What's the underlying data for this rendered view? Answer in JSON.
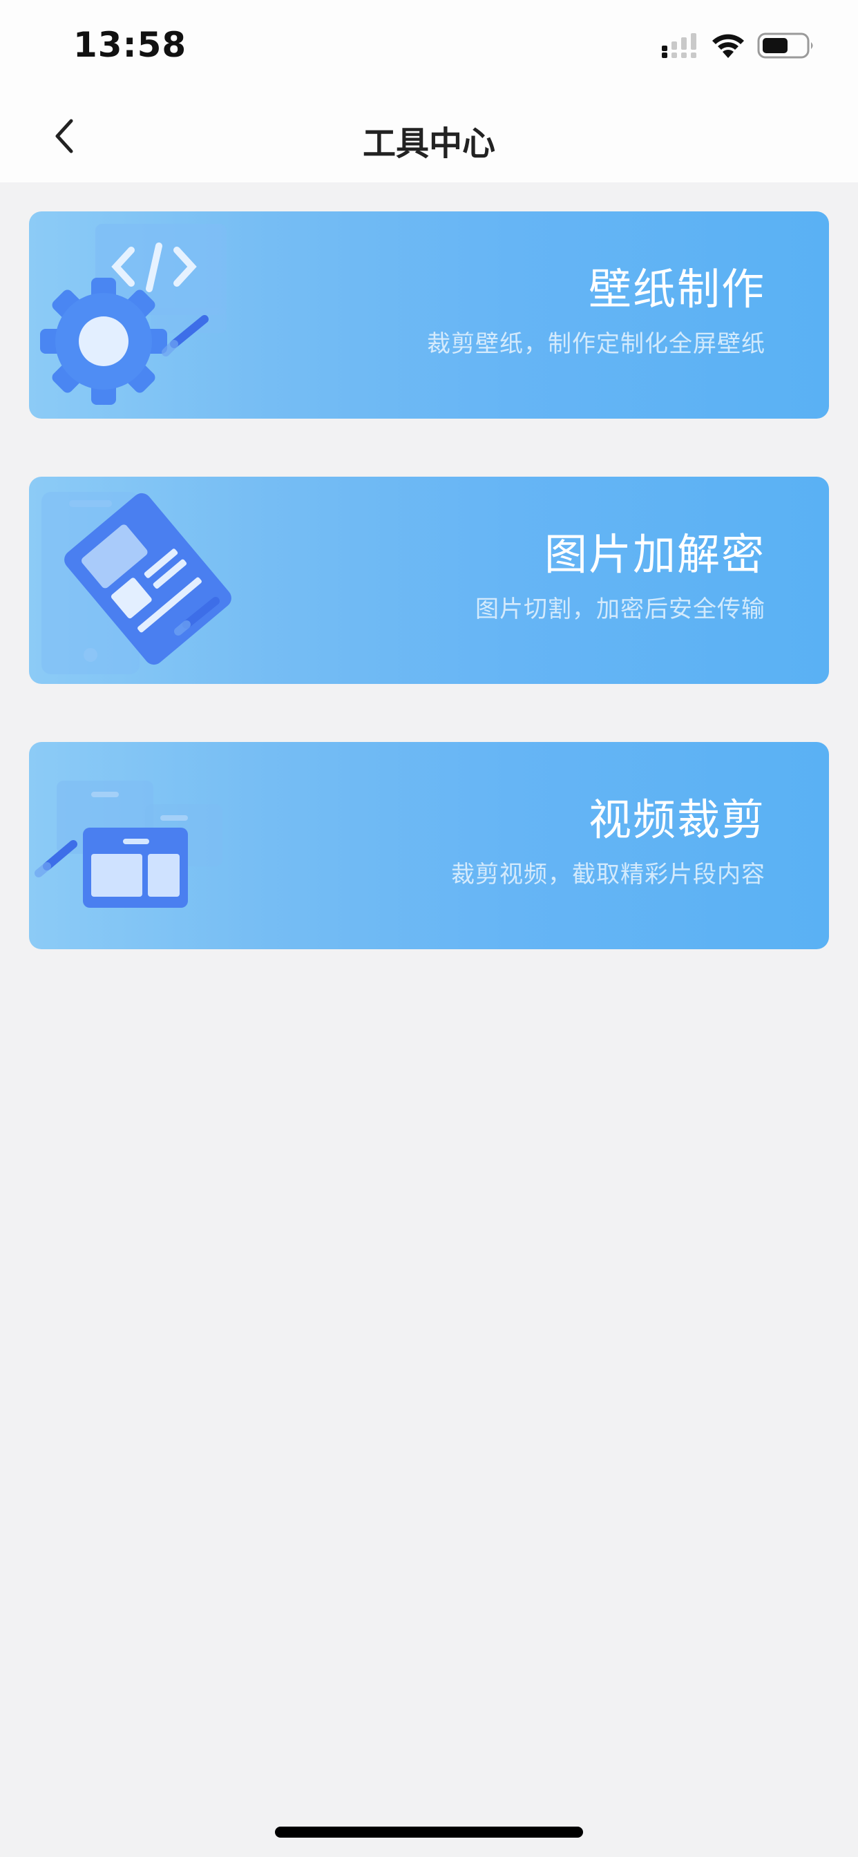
{
  "status_bar": {
    "time": "13:58"
  },
  "nav": {
    "title": "工具中心"
  },
  "tools": [
    {
      "title": "壁纸制作",
      "subtitle": "裁剪壁纸，制作定制化全屏壁纸",
      "icon": "gear-code-icon"
    },
    {
      "title": "图片加解密",
      "subtitle": "图片切割，加密后安全传输",
      "icon": "encrypted-card-icon"
    },
    {
      "title": "视频裁剪",
      "subtitle": "裁剪视频，截取精彩片段内容",
      "icon": "video-window-icon"
    }
  ],
  "colors": {
    "card_gradient_start": "#8ccbf6",
    "card_gradient_end": "#5ab1f4",
    "icon_blue": "#4a86f2",
    "background": "#f2f2f3"
  }
}
